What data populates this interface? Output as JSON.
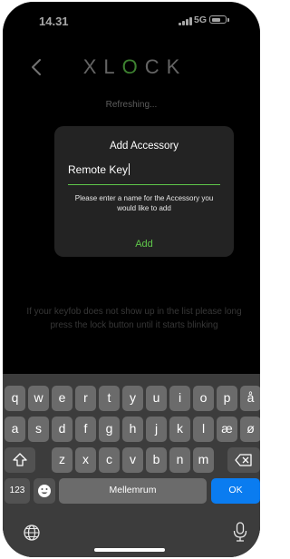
{
  "status_bar": {
    "time": "14.31",
    "network": "5G"
  },
  "app": {
    "logo": {
      "pre": "XL",
      "accent": "O",
      "post": "CK"
    },
    "refresh_text": "Refreshing...",
    "hint": [
      "If your keyfob does not show up in the list please long",
      "press the lock button until it starts blinking"
    ]
  },
  "dialog": {
    "title": "Add Accessory",
    "input_value": "Remote Key",
    "message": "Please enter a name for the Accessory you would like to add",
    "add_label": "Add"
  },
  "keyboard": {
    "row1": [
      "q",
      "w",
      "e",
      "r",
      "t",
      "y",
      "u",
      "i",
      "o",
      "p",
      "å"
    ],
    "row2": [
      "a",
      "s",
      "d",
      "f",
      "g",
      "h",
      "j",
      "k",
      "l",
      "æ",
      "ø"
    ],
    "row3": [
      "z",
      "x",
      "c",
      "v",
      "b",
      "n",
      "m"
    ],
    "numbers_label": "123",
    "space_label": "Mellemrum",
    "return_label": "OK"
  },
  "colors": {
    "accent": "#5fc74a",
    "keyboard_return": "#0a7cf0"
  },
  "icons": [
    "chevron-left-icon",
    "signal-icon",
    "battery-icon",
    "shift-icon",
    "backspace-icon",
    "emoji-icon",
    "globe-icon",
    "microphone-icon"
  ]
}
